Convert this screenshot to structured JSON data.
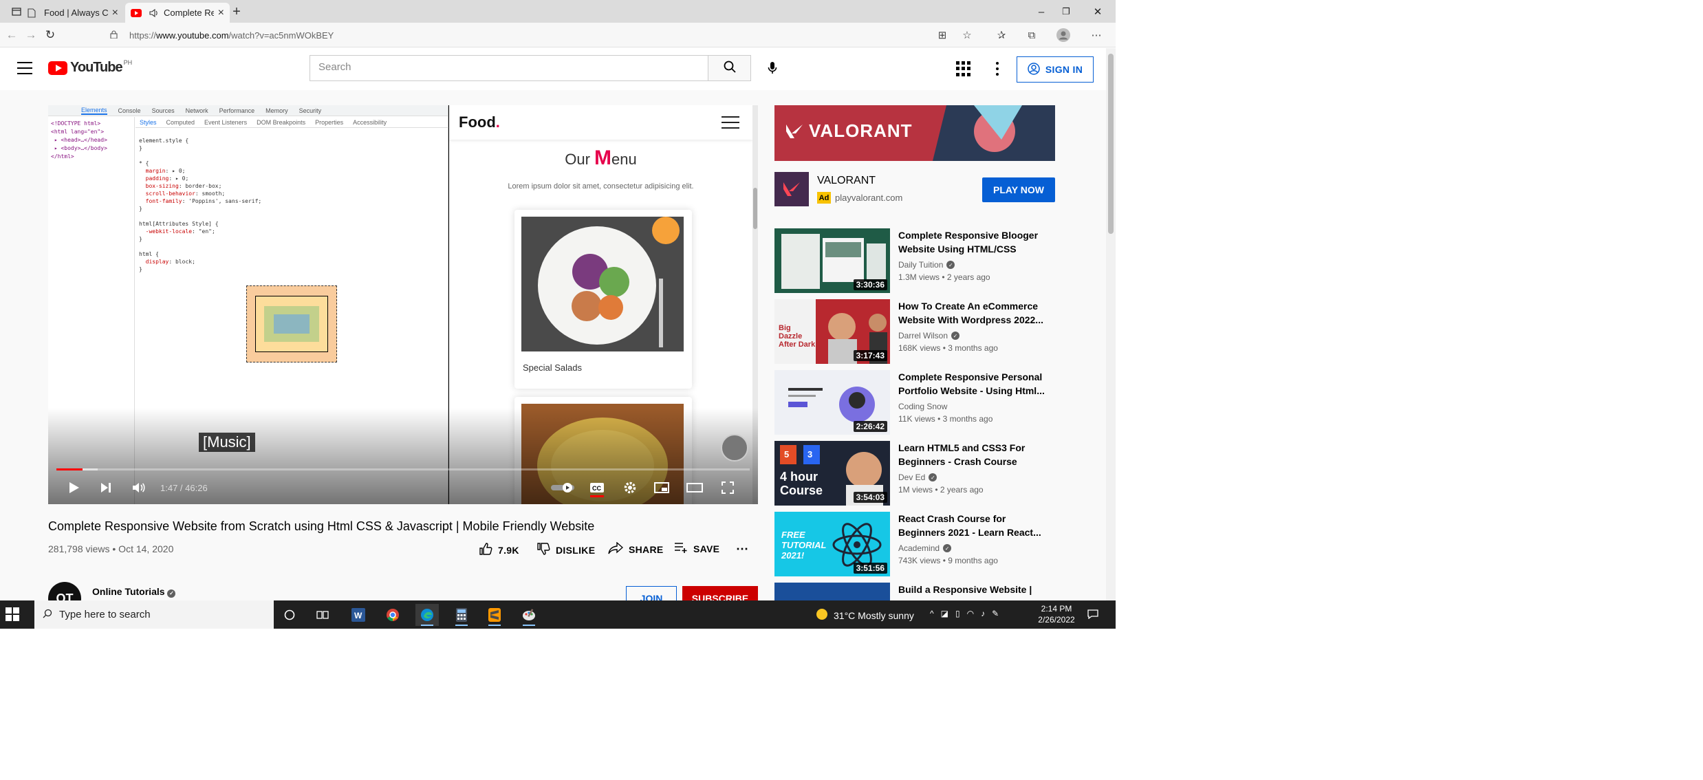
{
  "browser": {
    "tabs": [
      {
        "title": "Food | Always Choose Good",
        "active": false
      },
      {
        "title": "Complete Responsive Website",
        "active": true
      }
    ],
    "url_prefix": "https://",
    "url_host": "www.youtube.com",
    "url_path": "/watch?v=ac5nmWOkBEY"
  },
  "youtube": {
    "logo_text": "YouTube",
    "region": "PH",
    "search_placeholder": "Search",
    "sign_in": "SIGN IN"
  },
  "player": {
    "caption": "[Music]",
    "time": "1:47 / 46:26",
    "played_fraction": 0.038,
    "buffered_fraction": 0.06,
    "devtools": {
      "tabs": [
        "Elements",
        "Console",
        "Sources",
        "Network",
        "Performance",
        "Memory",
        "Security"
      ],
      "subtabs": [
        "Styles",
        "Computed",
        "Event Listeners",
        "DOM Breakpoints",
        "Properties",
        "Accessibility"
      ]
    },
    "site": {
      "brand": "Food",
      "heading_pre": "Our ",
      "heading_big": "M",
      "heading_post": "enu",
      "lorem": "Lorem ipsum dolor sit amet, consectetur adipisicing elit.",
      "card_label": "Special Salads"
    }
  },
  "video": {
    "title": "Complete Responsive Website from Scratch using Html CSS & Javascript | Mobile Friendly Website",
    "meta": "281,798 views • Oct 14, 2020",
    "likes": "7.9K",
    "dislike": "DISLIKE",
    "share": "SHARE",
    "save": "SAVE",
    "channel": "Online Tutorials",
    "channel_initials": "OT",
    "join": "JOIN",
    "subscribe": "SUBSCRIBE"
  },
  "ad": {
    "banner": "VALORANT",
    "name": "VALORANT",
    "badge": "Ad",
    "domain": "playvalorant.com",
    "cta": "PLAY NOW"
  },
  "recommendations": [
    {
      "title": "Complete Responsive Blooger Website Using HTML/CSS",
      "channel": "Daily Tuition",
      "meta": "1.3M views • 2 years ago",
      "duration": "3:30:36",
      "color": "#1f5b46"
    },
    {
      "title": "How To Create An eCommerce Website With Wordpress 2022...",
      "channel": "Darrel Wilson",
      "meta": "168K views • 3 months ago",
      "duration": "3:17:43",
      "color": "#b8282f",
      "thumb_text": "Big Dazzle After Dark"
    },
    {
      "title": "Complete Responsive Personal Portfolio Website - Using Html...",
      "channel": "Coding Snow",
      "meta": "11K views • 3 months ago",
      "duration": "2:26:42",
      "color": "#eef0f5"
    },
    {
      "title": "Learn HTML5 and CSS3 For Beginners - Crash Course",
      "channel": "Dev Ed",
      "meta": "1M views • 2 years ago",
      "duration": "3:54:03",
      "color": "#1e2535",
      "thumb_text": "4 hour Course"
    },
    {
      "title": "React Crash Course for Beginners 2021 - Learn React...",
      "channel": "Academind",
      "meta": "743K views • 9 months ago",
      "duration": "3:51:56",
      "color": "#16c7e6",
      "thumb_text": "FREE TUTORIAL 2021!"
    },
    {
      "title": "Build a Responsive Website |",
      "channel": "",
      "meta": "",
      "duration": "",
      "color": "#1a4f9a"
    }
  ],
  "taskbar": {
    "search_placeholder": "Type here to search",
    "weather": "31°C  Mostly sunny",
    "time": "2:14 PM",
    "date": "2/26/2022"
  }
}
